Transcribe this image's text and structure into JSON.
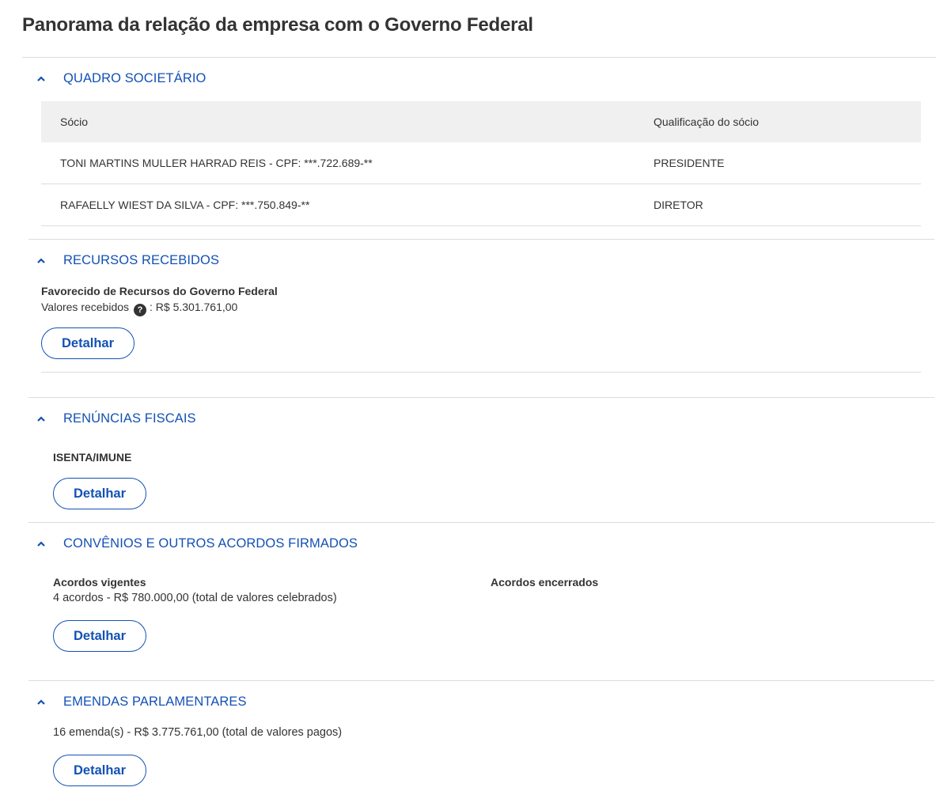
{
  "page_title": "Panorama da relação da empresa com o Governo Federal",
  "sections": {
    "quadro": {
      "title": "QUADRO SOCIETÁRIO",
      "table": {
        "headers": [
          "Sócio",
          "Qualificação do sócio"
        ],
        "rows": [
          [
            "TONI MARTINS MULLER HARRAD REIS - CPF: ***.722.689-**",
            "PRESIDENTE"
          ],
          [
            "RAFAELLY WIEST DA SILVA - CPF: ***.750.849-**",
            "DIRETOR"
          ]
        ]
      }
    },
    "recursos": {
      "title": "RECURSOS RECEBIDOS",
      "subtitle": "Favorecido de Recursos do Governo Federal",
      "valores_label": "Valores recebidos",
      "help_icon": "question-circle-icon",
      "valores_value": ": R$ 5.301.761,00",
      "button": "Detalhar"
    },
    "renuncias": {
      "title": "RENÚNCIAS FISCAIS",
      "status": "ISENTA/IMUNE",
      "button": "Detalhar"
    },
    "convenios": {
      "title": "CONVÊNIOS E OUTROS ACORDOS FIRMADOS",
      "vigentes_label": "Acordos vigentes",
      "vigentes_value": "4 acordos - R$ 780.000,00 (total de valores celebrados)",
      "encerrados_label": "Acordos encerrados",
      "button": "Detalhar"
    },
    "emendas": {
      "title": "EMENDAS PARLAMENTARES",
      "value": "16 emenda(s) - R$ 3.775.761,00 (total de valores pagos)",
      "button": "Detalhar"
    }
  },
  "colors": {
    "accent": "#1351b4",
    "text": "#333333",
    "table_header_bg": "#f0f0f0",
    "divider": "#dcdcdc"
  }
}
